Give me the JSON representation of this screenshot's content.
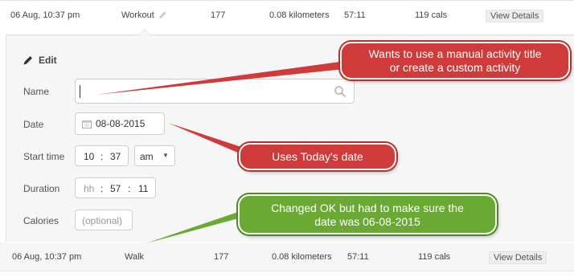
{
  "top_row": {
    "date": "06 Aug, 10:37 pm",
    "activity": "Workout",
    "value": "177",
    "distance": "0.08 kilometers",
    "time": "57:11",
    "calories": "119 cals",
    "view_label": "View Details"
  },
  "edit_panel": {
    "title": "Edit",
    "name_label": "Name",
    "name_value": "",
    "date_label": "Date",
    "date_value": "08-08-2015",
    "start_label": "Start time",
    "start_hour": "10",
    "start_minute": "37",
    "start_ampm": "am",
    "time_sep": ":",
    "duration_label": "Duration",
    "duration_hh": "hh",
    "duration_mm": "57",
    "duration_ss": "11",
    "calories_label": "Calories",
    "calories_placeholder": "(optional)"
  },
  "bottom_row": {
    "date": "06 Aug, 10:37 pm",
    "activity": "Walk",
    "value": "177",
    "distance": "0.08 kilometers",
    "time": "57:11",
    "calories": "119 cals",
    "view_label": "View Details"
  },
  "callouts": {
    "name_note_line1": "Wants to use a manual activity title",
    "name_note_line2": "or create a custom activity",
    "date_note": "Uses Today's date",
    "walk_note_line1": "Changed OK but had to make sure the",
    "walk_note_line2": "date was 06-08-2015"
  },
  "colors": {
    "callout_red": "#cf3b3b",
    "callout_green": "#6aaa34"
  },
  "icons": [
    "pencil-icon",
    "search-icon",
    "calendar-icon",
    "caret-down-icon"
  ]
}
